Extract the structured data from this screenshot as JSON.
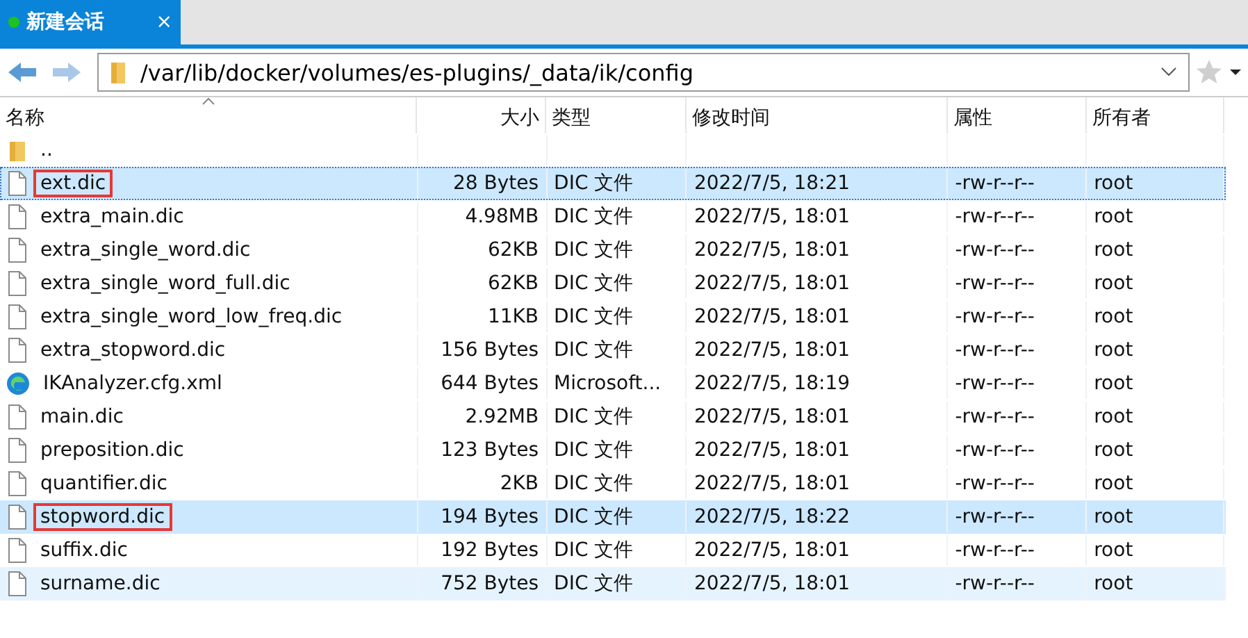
{
  "tabs": [
    {
      "label": "新建会话",
      "close": "×",
      "connected": true,
      "selected": true
    }
  ],
  "address": {
    "path": "/var/lib/docker/volumes/es-plugins/_data/ik/config"
  },
  "columns": [
    {
      "label": "名称",
      "sorted": true
    },
    {
      "label": "大小",
      "sorted": false
    },
    {
      "label": "类型",
      "sorted": false
    },
    {
      "label": "修改时间",
      "sorted": false
    },
    {
      "label": "属性",
      "sorted": false
    },
    {
      "label": "所有者",
      "sorted": false
    }
  ],
  "rows": [
    {
      "kind": "folder",
      "name": "..",
      "selected": false,
      "hover": false,
      "annotated": false
    },
    {
      "kind": "file",
      "name": "ext.dic",
      "size": "28 Bytes",
      "type": "DIC 文件",
      "modified": "2022/7/5, 18:21",
      "attributes": "-rw-r--r--",
      "owner": "root",
      "selected": true,
      "hover": false,
      "annotated": true
    },
    {
      "kind": "file",
      "name": "extra_main.dic",
      "size": "4.98MB",
      "type": "DIC 文件",
      "modified": "2022/7/5, 18:01",
      "attributes": "-rw-r--r--",
      "owner": "root",
      "selected": false,
      "hover": false,
      "annotated": false
    },
    {
      "kind": "file",
      "name": "extra_single_word.dic",
      "size": "62KB",
      "type": "DIC 文件",
      "modified": "2022/7/5, 18:01",
      "attributes": "-rw-r--r--",
      "owner": "root",
      "selected": false,
      "hover": false,
      "annotated": false
    },
    {
      "kind": "file",
      "name": "extra_single_word_full.dic",
      "size": "62KB",
      "type": "DIC 文件",
      "modified": "2022/7/5, 18:01",
      "attributes": "-rw-r--r--",
      "owner": "root",
      "selected": false,
      "hover": false,
      "annotated": false
    },
    {
      "kind": "file",
      "name": "extra_single_word_low_freq.dic",
      "size": "11KB",
      "type": "DIC 文件",
      "modified": "2022/7/5, 18:01",
      "attributes": "-rw-r--r--",
      "owner": "root",
      "selected": false,
      "hover": false,
      "annotated": false
    },
    {
      "kind": "file",
      "name": "extra_stopword.dic",
      "size": "156 Bytes",
      "type": "DIC 文件",
      "modified": "2022/7/5, 18:01",
      "attributes": "-rw-r--r--",
      "owner": "root",
      "selected": false,
      "hover": false,
      "annotated": false
    },
    {
      "kind": "browser",
      "name": "IKAnalyzer.cfg.xml",
      "size": "644 Bytes",
      "type": "Microsoft...",
      "modified": "2022/7/5, 18:19",
      "attributes": "-rw-r--r--",
      "owner": "root",
      "selected": false,
      "hover": false,
      "annotated": false
    },
    {
      "kind": "file",
      "name": "main.dic",
      "size": "2.92MB",
      "type": "DIC 文件",
      "modified": "2022/7/5, 18:01",
      "attributes": "-rw-r--r--",
      "owner": "root",
      "selected": false,
      "hover": false,
      "annotated": false
    },
    {
      "kind": "file",
      "name": "preposition.dic",
      "size": "123 Bytes",
      "type": "DIC 文件",
      "modified": "2022/7/5, 18:01",
      "attributes": "-rw-r--r--",
      "owner": "root",
      "selected": false,
      "hover": false,
      "annotated": false
    },
    {
      "kind": "file",
      "name": "quantifier.dic",
      "size": "2KB",
      "type": "DIC 文件",
      "modified": "2022/7/5, 18:01",
      "attributes": "-rw-r--r--",
      "owner": "root",
      "selected": false,
      "hover": false,
      "annotated": false
    },
    {
      "kind": "file",
      "name": "stopword.dic",
      "size": "194 Bytes",
      "type": "DIC 文件",
      "modified": "2022/7/5, 18:22",
      "attributes": "-rw-r--r--",
      "owner": "root",
      "selected": true,
      "hover": false,
      "annotated": true
    },
    {
      "kind": "file",
      "name": "suffix.dic",
      "size": "192 Bytes",
      "type": "DIC 文件",
      "modified": "2022/7/5, 18:01",
      "attributes": "-rw-r--r--",
      "owner": "root",
      "selected": false,
      "hover": false,
      "annotated": false
    },
    {
      "kind": "file",
      "name": "surname.dic",
      "size": "752 Bytes",
      "type": "DIC 文件",
      "modified": "2022/7/5, 18:01",
      "attributes": "-rw-r--r--",
      "owner": "root",
      "selected": false,
      "hover": true,
      "annotated": false
    }
  ]
}
